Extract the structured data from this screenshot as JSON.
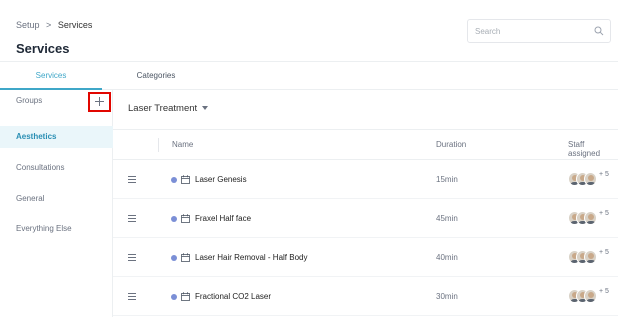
{
  "breadcrumb": {
    "parent": "Setup",
    "separator": ">",
    "current": "Services"
  },
  "page_title": "Services",
  "search": {
    "placeholder": "Search"
  },
  "tabs": [
    {
      "label": "Services",
      "active": true
    },
    {
      "label": "Categories",
      "active": false
    }
  ],
  "sidebar": {
    "groups_label": "Groups",
    "add_label": "+",
    "items": [
      {
        "label": "Aesthetics",
        "active": true
      },
      {
        "label": "Consultations",
        "active": false
      },
      {
        "label": "General",
        "active": false
      },
      {
        "label": "Everything Else",
        "active": false
      }
    ]
  },
  "main": {
    "category": "Laser Treatment",
    "columns": {
      "name": "Name",
      "duration": "Duration",
      "staff": "Staff assigned"
    },
    "rows": [
      {
        "name": "Laser Genesis",
        "duration": "15min",
        "staff_more": "+ 5"
      },
      {
        "name": "Fraxel Half face",
        "duration": "45min",
        "staff_more": "+ 5"
      },
      {
        "name": "Laser Hair Removal - Half Body",
        "duration": "40min",
        "staff_more": "+ 5"
      },
      {
        "name": "Fractional CO2 Laser",
        "duration": "30min",
        "staff_more": "+ 5"
      }
    ]
  },
  "colors": {
    "accent": "#3fa7c8",
    "highlight_box": "#e10600",
    "service_dot": "#7b8fd6"
  },
  "icons": [
    "search-icon",
    "plus-icon",
    "chevron-down-icon",
    "drag-handle-icon",
    "calendar-icon",
    "avatar"
  ]
}
